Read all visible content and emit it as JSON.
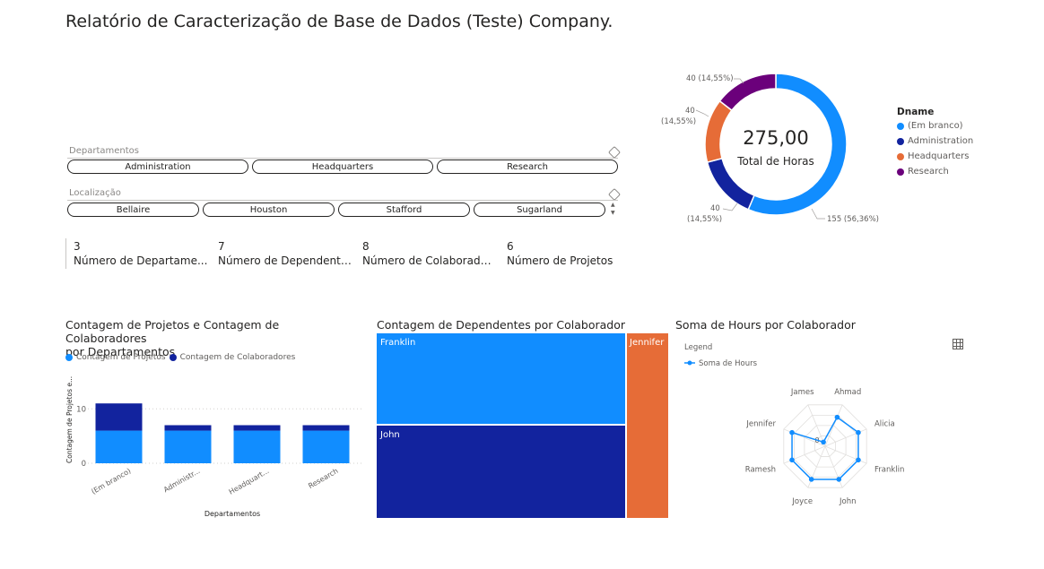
{
  "report": {
    "title": "Relatório de Caracterização de Base de Dados (Teste) Company."
  },
  "slicers": {
    "departamentos": {
      "label": "Departamentos",
      "options": [
        "Administration",
        "Headquarters",
        "Research"
      ]
    },
    "localizacao": {
      "label": "Localização",
      "options": [
        "Bellaire",
        "Houston",
        "Stafford",
        "Sugarland"
      ]
    }
  },
  "kpis": [
    {
      "value": "3",
      "label": "Número de Departame..."
    },
    {
      "value": "7",
      "label": "Número de Dependentes"
    },
    {
      "value": "8",
      "label": "Número de Colaborado..."
    },
    {
      "value": "6",
      "label": "Número de Projetos"
    }
  ],
  "donut": {
    "center_value": "275,00",
    "center_label": "Total de Horas",
    "legend_title": "Dname",
    "chart_data": {
      "type": "pie",
      "slices": [
        {
          "name": "(Em branco)",
          "value": 155,
          "label": "155 (56,36%)",
          "color": "#118DFF"
        },
        {
          "name": "Administration",
          "value": 40,
          "label_line1": "40",
          "label_line2": "(14,55%)",
          "color": "#12239E"
        },
        {
          "name": "Headquarters",
          "value": 40,
          "label_line1": "40",
          "label_line2": "(14,55%)",
          "color": "#E66C37"
        },
        {
          "name": "Research",
          "value": 40,
          "label": "40 (14,55%)",
          "color": "#6B007B"
        }
      ]
    }
  },
  "bar_chart": {
    "title_line1": "Contagem de Projetos e Contagem de Colaboradores",
    "title_line2": "por Departamentos",
    "legend": [
      {
        "name": "Contagem de Projetos",
        "color": "#118DFF"
      },
      {
        "name": "Contagem de Colaboradores",
        "color": "#12239E"
      }
    ],
    "chart_data": {
      "type": "bar",
      "stacked": true,
      "categories": [
        "(Em branco)",
        "Administr...",
        "Headquart...",
        "Research"
      ],
      "series": [
        {
          "name": "Contagem de Projetos",
          "values": [
            6,
            6,
            6,
            6
          ],
          "color": "#118DFF"
        },
        {
          "name": "Contagem de Colaboradores",
          "values": [
            5,
            1,
            1,
            1
          ],
          "color": "#12239E"
        }
      ],
      "yticks": [
        "0",
        "10"
      ],
      "ylim": [
        0,
        14
      ],
      "xlabel": "Departamentos",
      "ylabel": "Contagem de Projetos e..."
    }
  },
  "treemap": {
    "title": "Contagem de Dependentes por Colaborador",
    "chart_data": {
      "type": "treemap",
      "items": [
        {
          "name": "Franklin",
          "value": 3,
          "color": "#118DFF"
        },
        {
          "name": "John",
          "value": 3,
          "color": "#12239E"
        },
        {
          "name": "Jennifer",
          "value": 1,
          "color": "#E66C37"
        }
      ]
    }
  },
  "radar": {
    "title": "Soma de Hours por Colaborador",
    "legend_title": "Legend",
    "legend_series": "Soma de Hours",
    "center_label": "0",
    "chart_data": {
      "type": "radar",
      "axes": [
        "Ahmad",
        "Alicia",
        "Franklin",
        "John",
        "Joyce",
        "Ramesh",
        "Jennifer",
        "James"
      ],
      "values": [
        35,
        40,
        40,
        40,
        40,
        40,
        40,
        5
      ],
      "max": 50,
      "color": "#118DFF"
    }
  }
}
